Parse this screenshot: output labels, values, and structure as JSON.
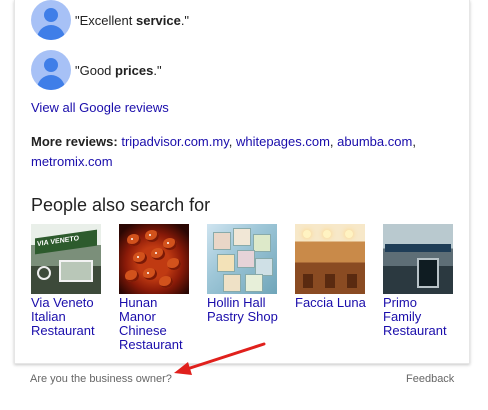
{
  "reviews": [
    {
      "prefix": "\"Excellent ",
      "bold": "service",
      "suffix": ".\""
    },
    {
      "prefix": "\"Good ",
      "bold": "prices",
      "suffix": ".\""
    }
  ],
  "view_all_label": "View all Google reviews",
  "more_reviews": {
    "label": "More reviews:",
    "links": [
      "tripadvisor.com.my",
      "whitepages.com",
      "abumba.com",
      "metromix.com"
    ]
  },
  "people_also_search": {
    "title": "People also search for",
    "items": [
      {
        "name": "Via Veneto Italian Restaurant",
        "thumb_sign_text": "VIA VENETO"
      },
      {
        "name": "Hunan Manor Chinese Restaurant"
      },
      {
        "name": "Hollin Hall Pastry Shop"
      },
      {
        "name": "Faccia Luna"
      },
      {
        "name": "Primo Family Restaurant"
      }
    ]
  },
  "footer": {
    "business_owner": "Are you the business owner?",
    "feedback": "Feedback"
  },
  "colors": {
    "link": "#1a0dab",
    "avatar_bg": "#a7c1f6",
    "avatar_fg": "#3f7ee8",
    "arrow": "#e0201c"
  }
}
